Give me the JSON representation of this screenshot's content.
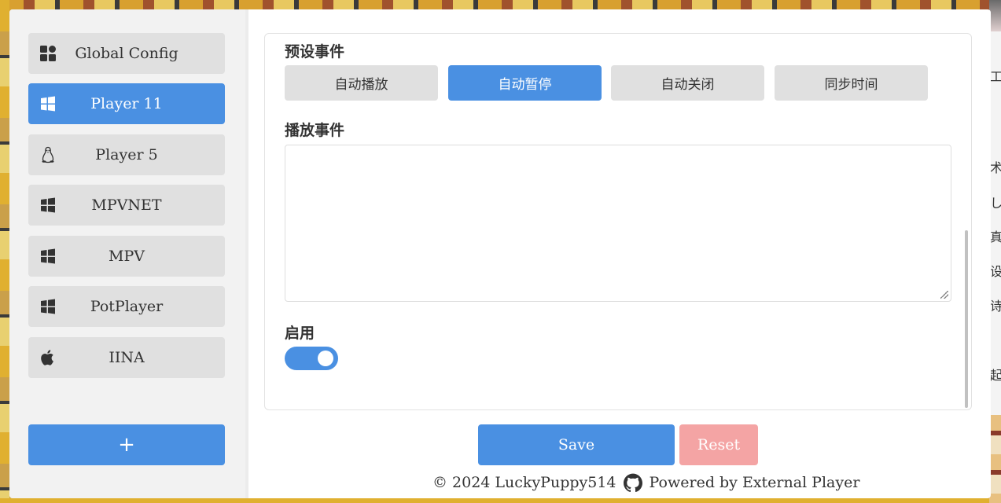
{
  "sidebar": {
    "items": [
      {
        "label": "Global Config",
        "icon": "grid-icon",
        "active": false
      },
      {
        "label": "Player 11",
        "icon": "windows-icon",
        "active": true
      },
      {
        "label": "Player 5",
        "icon": "linux-icon",
        "active": false
      },
      {
        "label": "MPVNET",
        "icon": "windows-icon",
        "active": false
      },
      {
        "label": "MPV",
        "icon": "windows-icon",
        "active": false
      },
      {
        "label": "PotPlayer",
        "icon": "windows-icon",
        "active": false
      },
      {
        "label": "IINA",
        "icon": "apple-icon",
        "active": false
      }
    ],
    "add_label": "+"
  },
  "panel": {
    "preset_heading": "预设事件",
    "presets": [
      {
        "label": "自动播放",
        "active": false
      },
      {
        "label": "自动暂停",
        "active": true
      },
      {
        "label": "自动关闭",
        "active": false
      },
      {
        "label": "同步时间",
        "active": false
      }
    ],
    "play_heading": "播放事件",
    "play_event_value": "",
    "enable_heading": "启用",
    "enabled": true
  },
  "actions": {
    "save_label": "Save",
    "reset_label": "Reset"
  },
  "footer": {
    "copyright": "© 2024 LuckyPuppy514",
    "powered": "Powered by External Player"
  },
  "background": {
    "right_glyphs": [
      "工",
      "术",
      "し",
      "真",
      "设",
      "诗",
      "起"
    ]
  },
  "colors": {
    "accent": "#4a90e2",
    "reset": "#f4a4a4",
    "button_bg": "#e0e0e0"
  }
}
